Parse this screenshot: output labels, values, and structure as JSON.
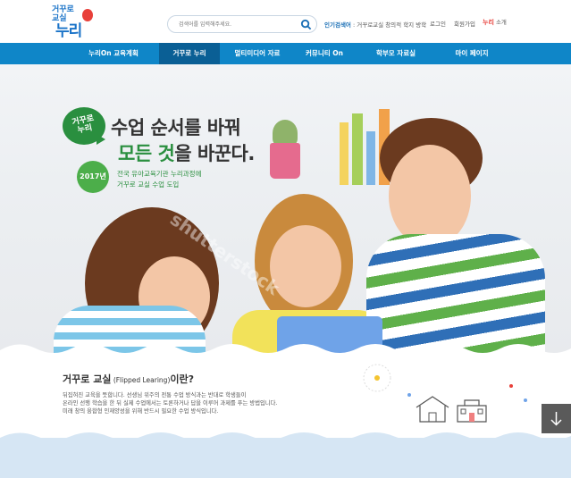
{
  "logo": {
    "top_text": "거꾸로",
    "top_text2": "교실",
    "main_text": "누리"
  },
  "search": {
    "placeholder": "검색어를 입력해주세요."
  },
  "popular": {
    "label": "인기검색어",
    "text": " : 거꾸로교실 창의적 학지 방학"
  },
  "util": {
    "login": "로그인",
    "join": "회원가입",
    "intro_brand": "누리",
    "intro_suffix": " 소개"
  },
  "nav": {
    "items": [
      {
        "label": "누리On 교육계획"
      },
      {
        "label": "거꾸로 누리"
      },
      {
        "label": "멀티미디어 자료"
      },
      {
        "label": "커뮤니티 On"
      },
      {
        "label": "학부모 자료실"
      },
      {
        "label": "마이 페이지"
      }
    ]
  },
  "hero": {
    "bubble": "거꾸로\n누리",
    "headline1": "수업 순서를 바꿔",
    "headline2_green": "모든 것",
    "headline2_rest": "을 바꾼다.",
    "year": "2017년",
    "sub1": "전국 유아교육기관 누리과정에",
    "sub2": "거꾸로 교실 수업 도입",
    "watermark": "shutterstock"
  },
  "intro": {
    "title_ko": "거꾸로 교실",
    "title_en": " (Flipped Learing)",
    "title_suffix": "이란?",
    "lines": [
      "뒤집혀진 교육을 뜻합니다. 선생님 위주의 전통 수업 방식과는 반대로 학생들이",
      "온라인 선행 학습을 한 뒤 실제 수업에서는 토론하거나 답을 이루어 과제를 푸는 방법입니다.",
      "미래 창의 융합형 인재양성을 위해 반드시 필요한 수업 방식입니다."
    ]
  },
  "colors": {
    "nav": "#0f86c8",
    "nav_active": "#0a5f95",
    "green": "#2a8f3f",
    "brand_red": "#e8403a"
  },
  "icons": [
    "search-icon",
    "arrow-down-icon",
    "house-icon",
    "school-icon"
  ]
}
